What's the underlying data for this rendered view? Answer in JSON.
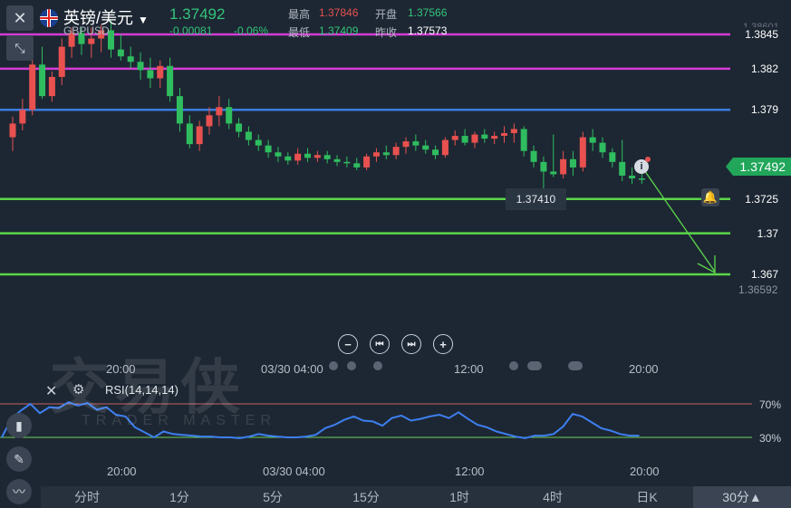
{
  "header": {
    "pair": "英镑/美元",
    "code": "GBPUSD",
    "price": "1.37492",
    "change": "-0.00081",
    "change_pct": "-0.06%",
    "high_label": "最高",
    "high_value": "1.37846",
    "open_label": "开盘",
    "open_value": "1.37566",
    "low_label": "最低",
    "low_value": "1.37409",
    "prev_close_label": "昨收",
    "prev_close_value": "1.37573",
    "top_axis_value": "1.38601"
  },
  "levels": [
    {
      "label": "1.3845",
      "value": 1.3845,
      "color": "#d63bd6"
    },
    {
      "label": "1.382",
      "value": 1.382,
      "color": "#d63bd6"
    },
    {
      "label": "1.379",
      "value": 1.379,
      "color": "#3a7be0"
    },
    {
      "label": "1.3725",
      "value": 1.3725,
      "color": "#5bd64a"
    },
    {
      "label": "1.37",
      "value": 1.37,
      "color": "#5bd64a"
    },
    {
      "label": "1.367",
      "value": 1.367,
      "color": "#5bd64a"
    }
  ],
  "current_price_tag": "1.37492",
  "low_marker_label": "1.37410",
  "bottom_axis_value": "1.36592",
  "time_ticks_main": [
    "20:00",
    "03/30 04:00",
    "12:00",
    "20:00"
  ],
  "time_ticks_rsi": [
    "20:00",
    "03/30 04:00",
    "12:00",
    "20:00"
  ],
  "rsi": {
    "label": "RSI(14,14,14)",
    "upper_label": "70%",
    "lower_label": "30%",
    "values": [
      30,
      52,
      62,
      70,
      59,
      66,
      65,
      72,
      68,
      71,
      63,
      66,
      57,
      55,
      42,
      36,
      30,
      37,
      34,
      33,
      32,
      31,
      31,
      30,
      30,
      29,
      31,
      34,
      32,
      31,
      30,
      30,
      31,
      33,
      41,
      45,
      51,
      55,
      50,
      49,
      44,
      53,
      56,
      50,
      52,
      55,
      57,
      53,
      60,
      52,
      45,
      42,
      37,
      34,
      31,
      29,
      32,
      32,
      34,
      43,
      58,
      55,
      48,
      41,
      38,
      34,
      32,
      32
    ]
  },
  "chart_data": {
    "type": "candlestick",
    "ylim": [
      1.36592,
      1.38601
    ],
    "candles": [
      [
        1.377,
        1.3785,
        1.376,
        1.378
      ],
      [
        1.378,
        1.3798,
        1.3775,
        1.379
      ],
      [
        1.379,
        1.3828,
        1.3786,
        1.3823
      ],
      [
        1.3823,
        1.3836,
        1.3798,
        1.38
      ],
      [
        1.38,
        1.3818,
        1.3796,
        1.3814
      ],
      [
        1.3814,
        1.3842,
        1.3808,
        1.3836
      ],
      [
        1.3836,
        1.385,
        1.3828,
        1.3846
      ],
      [
        1.3846,
        1.385,
        1.383,
        1.3838
      ],
      [
        1.3838,
        1.385,
        1.3828,
        1.3842
      ],
      [
        1.3842,
        1.3852,
        1.3832,
        1.3848
      ],
      [
        1.3848,
        1.3855,
        1.3828,
        1.3834
      ],
      [
        1.3834,
        1.3845,
        1.3826,
        1.3829
      ],
      [
        1.3829,
        1.3836,
        1.382,
        1.3825
      ],
      [
        1.3825,
        1.3832,
        1.3812,
        1.3819
      ],
      [
        1.3819,
        1.3828,
        1.3806,
        1.3813
      ],
      [
        1.3813,
        1.3826,
        1.3806,
        1.3822
      ],
      [
        1.3822,
        1.3828,
        1.3796,
        1.38
      ],
      [
        1.38,
        1.3806,
        1.3774,
        1.378
      ],
      [
        1.378,
        1.3786,
        1.3762,
        1.3765
      ],
      [
        1.3765,
        1.3782,
        1.376,
        1.3778
      ],
      [
        1.3778,
        1.3792,
        1.3772,
        1.3786
      ],
      [
        1.3786,
        1.38,
        1.3778,
        1.3792
      ],
      [
        1.3792,
        1.3798,
        1.3776,
        1.378
      ],
      [
        1.378,
        1.3784,
        1.377,
        1.3774
      ],
      [
        1.3774,
        1.3778,
        1.3764,
        1.3768
      ],
      [
        1.3768,
        1.3772,
        1.376,
        1.3764
      ],
      [
        1.3764,
        1.3768,
        1.3755,
        1.3759
      ],
      [
        1.3759,
        1.3763,
        1.3752,
        1.3756
      ],
      [
        1.3756,
        1.3759,
        1.375,
        1.3753
      ],
      [
        1.3753,
        1.3762,
        1.375,
        1.3758
      ],
      [
        1.3758,
        1.3762,
        1.3752,
        1.3755
      ],
      [
        1.3755,
        1.376,
        1.3752,
        1.3757
      ],
      [
        1.3757,
        1.376,
        1.3751,
        1.3754
      ],
      [
        1.3754,
        1.3757,
        1.3749,
        1.3752
      ],
      [
        1.3752,
        1.3756,
        1.3748,
        1.3751
      ],
      [
        1.3751,
        1.3755,
        1.3746,
        1.3748
      ],
      [
        1.3748,
        1.3758,
        1.3746,
        1.3756
      ],
      [
        1.3756,
        1.3762,
        1.3752,
        1.3759
      ],
      [
        1.3759,
        1.3764,
        1.3754,
        1.3757
      ],
      [
        1.3757,
        1.3766,
        1.3754,
        1.3763
      ],
      [
        1.3763,
        1.377,
        1.3758,
        1.3767
      ],
      [
        1.3767,
        1.3772,
        1.376,
        1.3764
      ],
      [
        1.3764,
        1.3768,
        1.3758,
        1.3761
      ],
      [
        1.3761,
        1.3764,
        1.3754,
        1.3757
      ],
      [
        1.3757,
        1.377,
        1.3755,
        1.3768
      ],
      [
        1.3768,
        1.3775,
        1.3764,
        1.3771
      ],
      [
        1.3771,
        1.3776,
        1.3764,
        1.3766
      ],
      [
        1.3766,
        1.3774,
        1.3762,
        1.3772
      ],
      [
        1.3772,
        1.3776,
        1.3766,
        1.3769
      ],
      [
        1.3769,
        1.3774,
        1.3765,
        1.3771
      ],
      [
        1.3771,
        1.3778,
        1.3766,
        1.3773
      ],
      [
        1.3773,
        1.378,
        1.3766,
        1.3776
      ],
      [
        1.3776,
        1.3778,
        1.3756,
        1.376
      ],
      [
        1.376,
        1.3764,
        1.3748,
        1.3752
      ],
      [
        1.3752,
        1.3756,
        1.3732,
        1.3745
      ],
      [
        1.3745,
        1.3772,
        1.3741,
        1.3743
      ],
      [
        1.3743,
        1.376,
        1.374,
        1.3754
      ],
      [
        1.3754,
        1.376,
        1.3742,
        1.3748
      ],
      [
        1.3748,
        1.3774,
        1.3745,
        1.377
      ],
      [
        1.377,
        1.3776,
        1.376,
        1.3766
      ],
      [
        1.3766,
        1.377,
        1.3755,
        1.3759
      ],
      [
        1.3759,
        1.3762,
        1.3748,
        1.3752
      ],
      [
        1.3752,
        1.3768,
        1.3738,
        1.3742
      ],
      [
        1.3742,
        1.3748,
        1.3736,
        1.374
      ],
      [
        1.374,
        1.3744,
        1.3736,
        1.3739
      ]
    ]
  },
  "tabs": [
    {
      "label": "分时"
    },
    {
      "label": "1分"
    },
    {
      "label": "5分"
    },
    {
      "label": "15分"
    },
    {
      "label": "1时"
    },
    {
      "label": "4时"
    },
    {
      "label": "日K"
    },
    {
      "label": "30分▲"
    }
  ],
  "colors": {
    "up": "#e8514f",
    "down": "#2fbd5f",
    "rsi_line": "#3d7ff0",
    "upper_band": "#c76262",
    "lower_band": "#6fd25a"
  },
  "watermark": {
    "cn": "交易侠",
    "en": "TRADER MASTER"
  }
}
